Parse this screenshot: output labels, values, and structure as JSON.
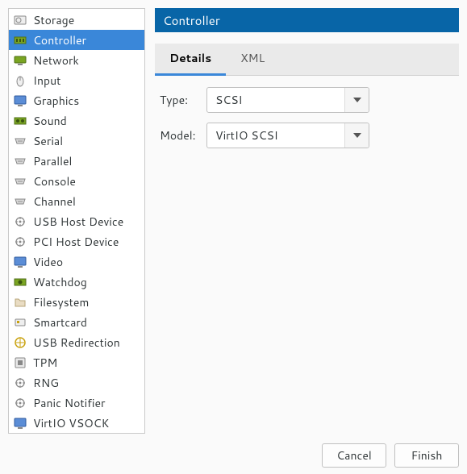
{
  "sidebar": {
    "items": [
      {
        "label": "Storage",
        "icon": "storage-icon"
      },
      {
        "label": "Controller",
        "icon": "controller-icon",
        "selected": true
      },
      {
        "label": "Network",
        "icon": "network-icon"
      },
      {
        "label": "Input",
        "icon": "input-icon"
      },
      {
        "label": "Graphics",
        "icon": "graphics-icon"
      },
      {
        "label": "Sound",
        "icon": "sound-icon"
      },
      {
        "label": "Serial",
        "icon": "serial-icon"
      },
      {
        "label": "Parallel",
        "icon": "parallel-icon"
      },
      {
        "label": "Console",
        "icon": "console-icon"
      },
      {
        "label": "Channel",
        "icon": "channel-icon"
      },
      {
        "label": "USB Host Device",
        "icon": "usb-icon"
      },
      {
        "label": "PCI Host Device",
        "icon": "pci-icon"
      },
      {
        "label": "Video",
        "icon": "video-icon"
      },
      {
        "label": "Watchdog",
        "icon": "watchdog-icon"
      },
      {
        "label": "Filesystem",
        "icon": "filesystem-icon"
      },
      {
        "label": "Smartcard",
        "icon": "smartcard-icon"
      },
      {
        "label": "USB Redirection",
        "icon": "usb-redir-icon"
      },
      {
        "label": "TPM",
        "icon": "tpm-icon"
      },
      {
        "label": "RNG",
        "icon": "rng-icon"
      },
      {
        "label": "Panic Notifier",
        "icon": "panic-icon"
      },
      {
        "label": "VirtIO VSOCK",
        "icon": "vsock-icon"
      }
    ]
  },
  "header": {
    "title": "Controller"
  },
  "tabs": {
    "items": [
      {
        "label": "Details",
        "active": true
      },
      {
        "label": "XML"
      }
    ]
  },
  "form": {
    "type_label": "Type:",
    "type_value": "SCSI",
    "model_label": "Model:",
    "model_value": "VirtIO SCSI"
  },
  "buttons": {
    "cancel": "Cancel",
    "finish": "Finish"
  },
  "colors": {
    "selection": "#3a87d9",
    "header_bg": "#0865a7"
  }
}
